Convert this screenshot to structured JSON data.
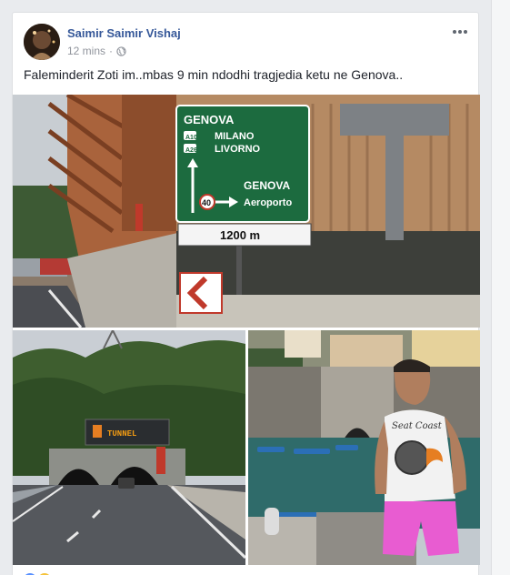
{
  "post": {
    "author": "Saimir Saimir Vishaj",
    "time": "12 mins",
    "separator": "·",
    "privacy_icon": "globe-icon",
    "text": "Faleminderit Zoti im..mbas 9 min ndodhi tragjedia ketu ne Genova.."
  },
  "photo1": {
    "sign_title": "GENOVA",
    "route1_badge": "A10",
    "route1": "MILANO",
    "route2_badge": "A26",
    "route2": "LIVORNO",
    "exit_city": "GENOVA",
    "exit_sub": "Aeroporto",
    "speed": "40",
    "distance": "1200 m"
  },
  "photo2": {
    "vms_text": "TUNNEL"
  },
  "photo3": {
    "shirt_text": "Seat Coast"
  },
  "colors": {
    "link": "#365899",
    "sign_green": "#1c6b3f",
    "card_bg": "#ffffff",
    "page_bg": "#e9ebee"
  },
  "icons": [
    "globe-icon",
    "more-options-icon",
    "like-reaction-icon",
    "love-reaction-icon"
  ]
}
